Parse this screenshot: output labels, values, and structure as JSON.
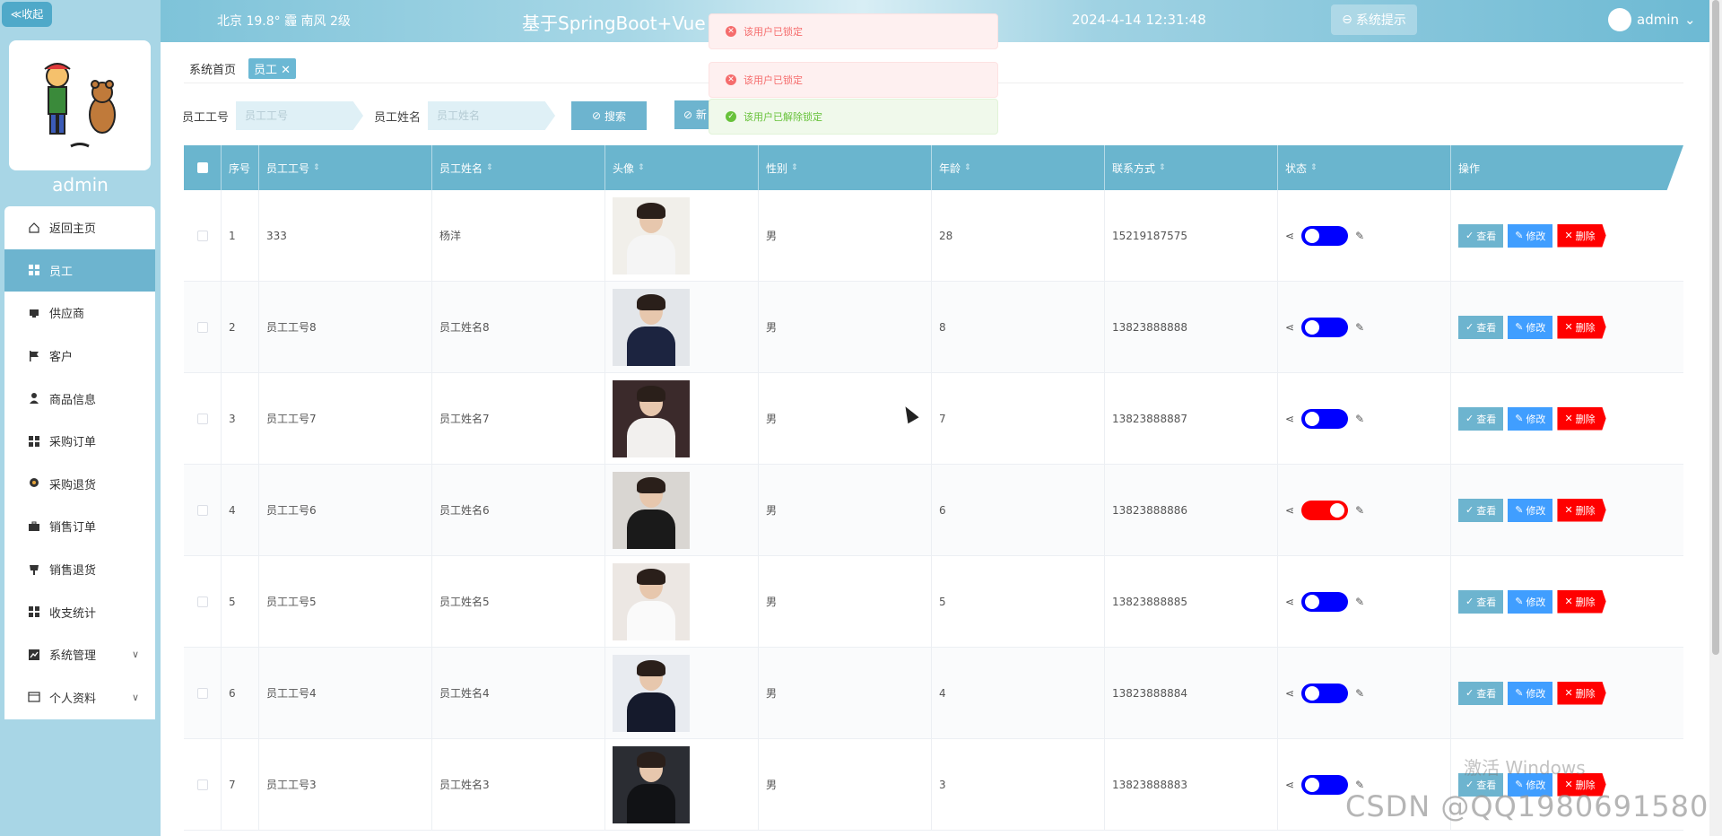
{
  "sidebar": {
    "collapse_label": "≪收起",
    "username": "admin",
    "items": [
      {
        "label": "返回主页",
        "icon": "home-icon"
      },
      {
        "label": "员工",
        "icon": "grid-icon",
        "active": true
      },
      {
        "label": "供应商",
        "icon": "box-icon"
      },
      {
        "label": "客户",
        "icon": "flag-icon"
      },
      {
        "label": "商品信息",
        "icon": "person-icon"
      },
      {
        "label": "采购订单",
        "icon": "grid-icon"
      },
      {
        "label": "采购退货",
        "icon": "pin-icon"
      },
      {
        "label": "销售订单",
        "icon": "briefcase-icon"
      },
      {
        "label": "销售退货",
        "icon": "cup-icon"
      },
      {
        "label": "收支统计",
        "icon": "grid-icon"
      },
      {
        "label": "系统管理",
        "icon": "chart-icon",
        "chevron": true
      },
      {
        "label": "个人资料",
        "icon": "card-icon",
        "chevron": true
      }
    ]
  },
  "header": {
    "weather": "北京 19.8° 霾 南风 2级",
    "title": "基于SpringBoot+Vue",
    "datetime": "2024-4-14 12:31:48",
    "notice_label": "系统提示",
    "user": "admin"
  },
  "breadcrumb": {
    "home": "系统首页",
    "current": "员工"
  },
  "search": {
    "label_id": "员工工号",
    "placeholder_id": "员工工号",
    "label_name": "员工姓名",
    "placeholder_name": "员工姓名",
    "search_label": "搜索",
    "add_label": "新"
  },
  "toasts": [
    {
      "type": "error",
      "text": "该用户已锁定"
    },
    {
      "type": "error",
      "text": "该用户已锁定"
    },
    {
      "type": "success",
      "text": "该用户已解除锁定"
    }
  ],
  "table": {
    "columns": [
      "序号",
      "员工工号",
      "员工姓名",
      "头像",
      "性别",
      "年龄",
      "联系方式",
      "状态",
      "操作"
    ],
    "actions": {
      "view": "查看",
      "edit": "修改",
      "delete": "删除"
    },
    "rows": [
      {
        "no": "1",
        "emp_id": "333",
        "name": "杨洋",
        "gender": "男",
        "age": "28",
        "phone": "15219187575",
        "locked": false,
        "photo_bg": "#f1efea",
        "photo_body": "#f5f5f5"
      },
      {
        "no": "2",
        "emp_id": "员工工号8",
        "name": "员工姓名8",
        "gender": "男",
        "age": "8",
        "phone": "13823888888",
        "locked": false,
        "photo_bg": "#e3e6ea",
        "photo_body": "#1c2440"
      },
      {
        "no": "3",
        "emp_id": "员工工号7",
        "name": "员工姓名7",
        "gender": "男",
        "age": "7",
        "phone": "13823888887",
        "locked": false,
        "photo_bg": "#3b2a2b",
        "photo_body": "#f2f0ee"
      },
      {
        "no": "4",
        "emp_id": "员工工号6",
        "name": "员工姓名6",
        "gender": "男",
        "age": "6",
        "phone": "13823888886",
        "locked": true,
        "photo_bg": "#d9d6d2",
        "photo_body": "#1a1a1a"
      },
      {
        "no": "5",
        "emp_id": "员工工号5",
        "name": "员工姓名5",
        "gender": "男",
        "age": "5",
        "phone": "13823888885",
        "locked": false,
        "photo_bg": "#ece7e3",
        "photo_body": "#fafafa"
      },
      {
        "no": "6",
        "emp_id": "员工工号4",
        "name": "员工姓名4",
        "gender": "男",
        "age": "4",
        "phone": "13823888884",
        "locked": false,
        "photo_bg": "#e8ebf0",
        "photo_body": "#151a2c"
      },
      {
        "no": "7",
        "emp_id": "员工工号3",
        "name": "员工姓名3",
        "gender": "男",
        "age": "3",
        "phone": "13823888883",
        "locked": false,
        "photo_bg": "#2b2d33",
        "photo_body": "#111215"
      }
    ]
  },
  "colors": {
    "toggle_on": "#0000ff",
    "toggle_locked": "#ff0000"
  },
  "watermarks": {
    "windows": "激活 Windows",
    "csdn": "CSDN @QQ1980691580"
  }
}
